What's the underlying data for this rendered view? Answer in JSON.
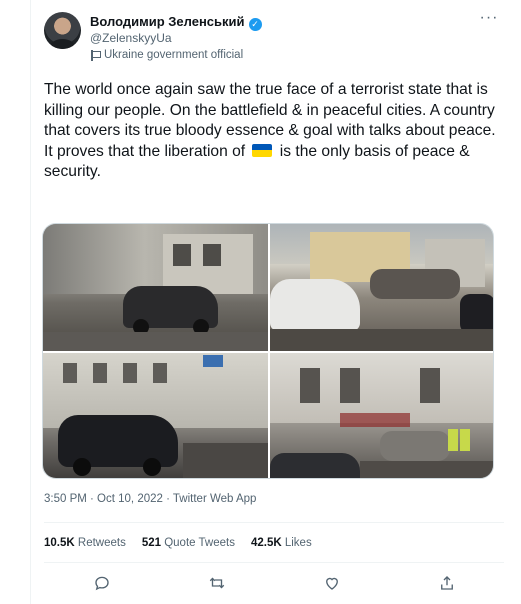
{
  "author": {
    "name": "Володимир Зеленський",
    "handle": "@ZelenskyyUa",
    "label": "Ukraine government official",
    "verified": true
  },
  "tweet": {
    "text_before_flag": "The world once again saw the true face of a terrorist state that is killing our people. On the battlefield & in peaceful cities. A country that covers its true bloody essence & goal with talks about peace. It proves that the liberation of",
    "flag_emoji": "ukraine-flag",
    "text_after_flag": "is the only basis of peace & security."
  },
  "media": {
    "count": 4
  },
  "meta": {
    "timestamp": "3:50 PM · Oct 10, 2022 · Twitter Web App"
  },
  "stats": {
    "retweets_count": "10.5K",
    "retweets_label": "Retweets",
    "quotes_count": "521",
    "quotes_label": "Quote Tweets",
    "likes_count": "42.5K",
    "likes_label": "Likes"
  },
  "actions": [
    "reply-icon",
    "retweet-icon",
    "like-icon",
    "share-icon"
  ],
  "colors": {
    "accent": "#1d9bf0",
    "text": "#0f1419",
    "muted": "#536471",
    "flag_blue": "#0057b7",
    "flag_yellow": "#ffd700"
  }
}
